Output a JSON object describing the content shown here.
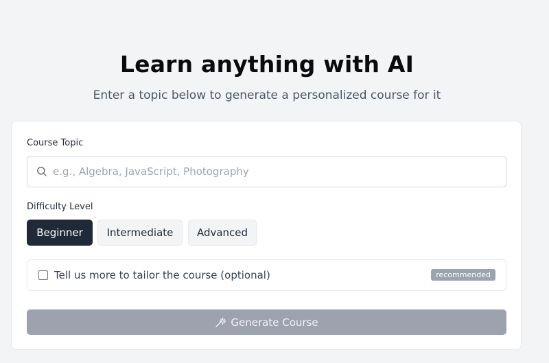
{
  "hero": {
    "title": "Learn anything with AI",
    "subtitle": "Enter a topic below to generate a personalized course for it"
  },
  "form": {
    "topic": {
      "label": "Course Topic",
      "placeholder": "e.g., Algebra, JavaScript, Photography",
      "value": "",
      "icon": "search-icon"
    },
    "difficulty": {
      "label": "Difficulty Level",
      "options": [
        {
          "label": "Beginner",
          "selected": true
        },
        {
          "label": "Intermediate",
          "selected": false
        },
        {
          "label": "Advanced",
          "selected": false
        }
      ]
    },
    "tailor": {
      "label": "Tell us more to tailor the course (optional)",
      "checked": false,
      "badge": "recommended"
    },
    "submit": {
      "label": "Generate Course",
      "icon": "wand-icon",
      "disabled": true
    }
  },
  "colors": {
    "background": "#f3f4f6",
    "card": "#ffffff",
    "accent_dark": "#1f2937",
    "disabled_button": "#9ca3af"
  }
}
